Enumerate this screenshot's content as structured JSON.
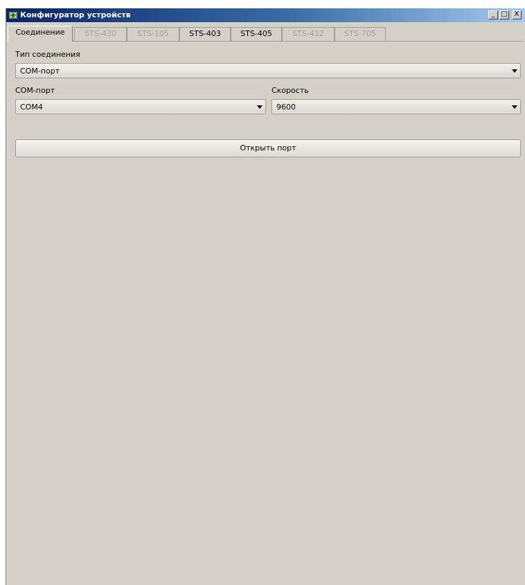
{
  "window": {
    "title": "Конфигуратор устройств",
    "controls": {
      "minimize": "_",
      "maximize": "□",
      "close": "X"
    }
  },
  "tabs": [
    {
      "label": "Соединение",
      "state": "active"
    },
    {
      "label": "STS-430",
      "state": "disabled"
    },
    {
      "label": "STS-105",
      "state": "disabled"
    },
    {
      "label": "STS-403",
      "state": "enabled"
    },
    {
      "label": "STS-405",
      "state": "enabled"
    },
    {
      "label": "STS-412",
      "state": "disabled"
    },
    {
      "label": "STS-705",
      "state": "disabled"
    }
  ],
  "connection": {
    "type_label": "Тип соединения",
    "type_value": "COM-порт",
    "port_label": "COM-порт",
    "port_value": "COM4",
    "speed_label": "Скорость",
    "speed_value": "9600",
    "open_button": "Открыть порт"
  },
  "icons": {
    "app": "device-configurator-icon",
    "dropdown": "chevron-down-icon"
  },
  "colors": {
    "titlebar_start": "#0a246a",
    "titlebar_end": "#a6caf0",
    "window_bg": "#d4d0c8",
    "disabled_text": "#a19f9a"
  }
}
